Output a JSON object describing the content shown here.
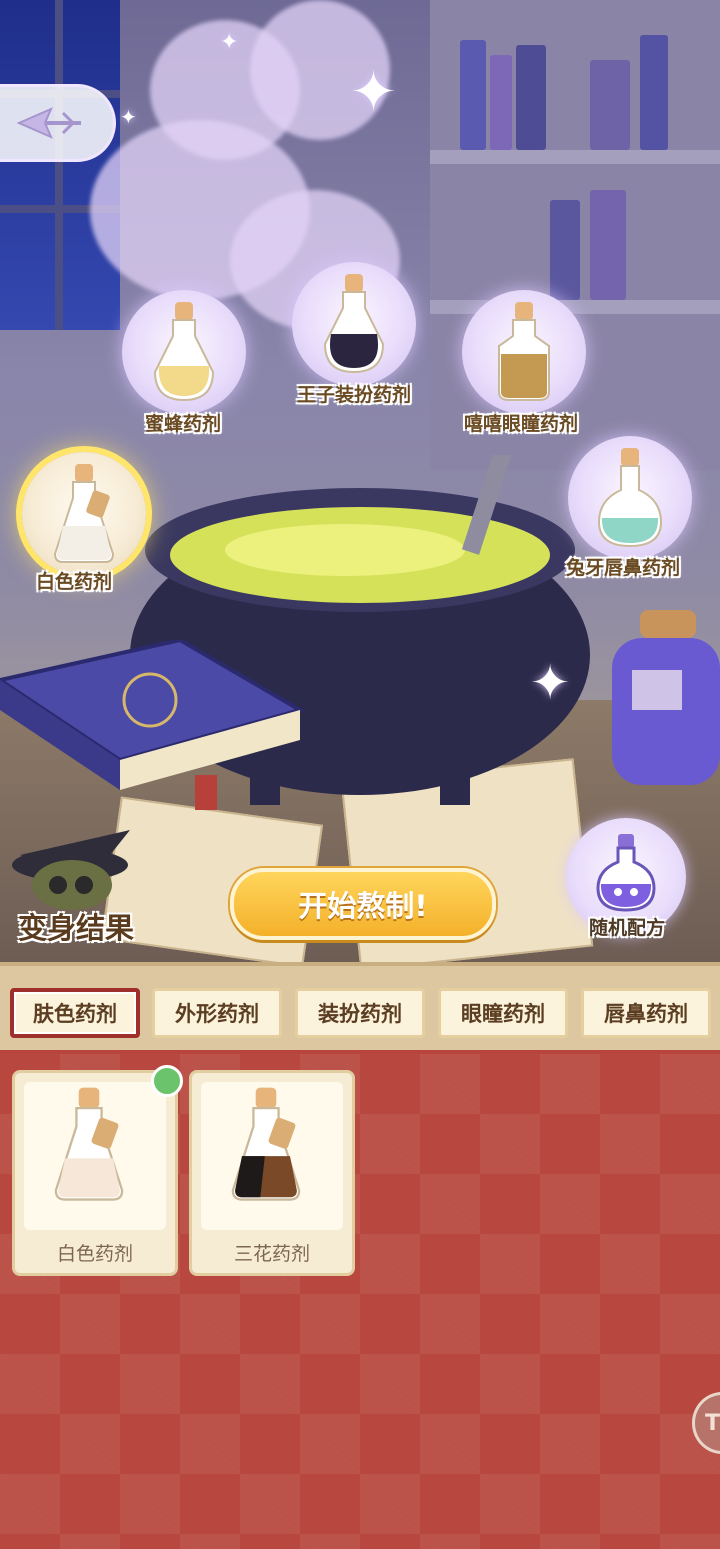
{
  "header": {
    "back_icon": "back-arrow-icon"
  },
  "potions": [
    {
      "label": "蜜蜂药剂",
      "icon": "bee-potion-icon",
      "liquid": "#f3d98a"
    },
    {
      "label": "王子装扮药剂",
      "icon": "prince-potion-icon",
      "liquid": "#2b2540"
    },
    {
      "label": "嘻嘻眼瞳药剂",
      "icon": "eye-potion-icon",
      "liquid": "#c49a52"
    },
    {
      "label": "白色药剂",
      "icon": "white-potion-icon",
      "liquid": "#f4efe6",
      "selected": true
    },
    {
      "label": "兔牙唇鼻药剂",
      "icon": "rabbit-potion-icon",
      "liquid": "#8fd6c6"
    }
  ],
  "result": {
    "label": "变身结果",
    "icon": "witch-hat-icon"
  },
  "brew_button": {
    "label": "开始熬制!"
  },
  "random": {
    "label": "随机配方",
    "icon": "flask-icon"
  },
  "tabs": [
    {
      "label": "肤色药剂",
      "active": true
    },
    {
      "label": "外形药剂"
    },
    {
      "label": "装扮药剂"
    },
    {
      "label": "眼瞳药剂"
    },
    {
      "label": "唇鼻药剂"
    }
  ],
  "inventory": [
    {
      "name": "白色药剂",
      "icon": "white-potion-icon",
      "checked": true
    },
    {
      "name": "三花药剂",
      "icon": "calico-potion-icon",
      "checked": false
    }
  ],
  "side_badge": {
    "text": "T"
  },
  "colors": {
    "accent": "#f4b12a",
    "tab_active_border": "#9e2f2b",
    "grid_bg": "#b8483f",
    "check": "#6bc46b"
  }
}
